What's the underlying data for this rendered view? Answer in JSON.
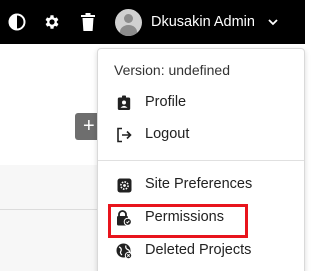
{
  "header": {
    "user_name": "Dkusakin Admin",
    "icons": [
      "theme-toggle-icon",
      "gear-icon",
      "trash-icon",
      "avatar",
      "chevron-down-icon"
    ],
    "background_color": "#000000"
  },
  "background": {
    "add_button_label": "+"
  },
  "user_dropdown": {
    "version_text": "Version: undefined",
    "items": [
      {
        "label": "Profile",
        "icon": "id-badge-icon"
      },
      {
        "label": "Logout",
        "icon": "logout-icon"
      },
      {
        "label": "Site Preferences",
        "icon": "gear-icon"
      },
      {
        "label": "Permissions",
        "icon": "lock-icon",
        "highlighted": true
      },
      {
        "label": "Deleted Projects",
        "icon": "globe-icon"
      }
    ],
    "highlight_color": "#e8141c"
  }
}
